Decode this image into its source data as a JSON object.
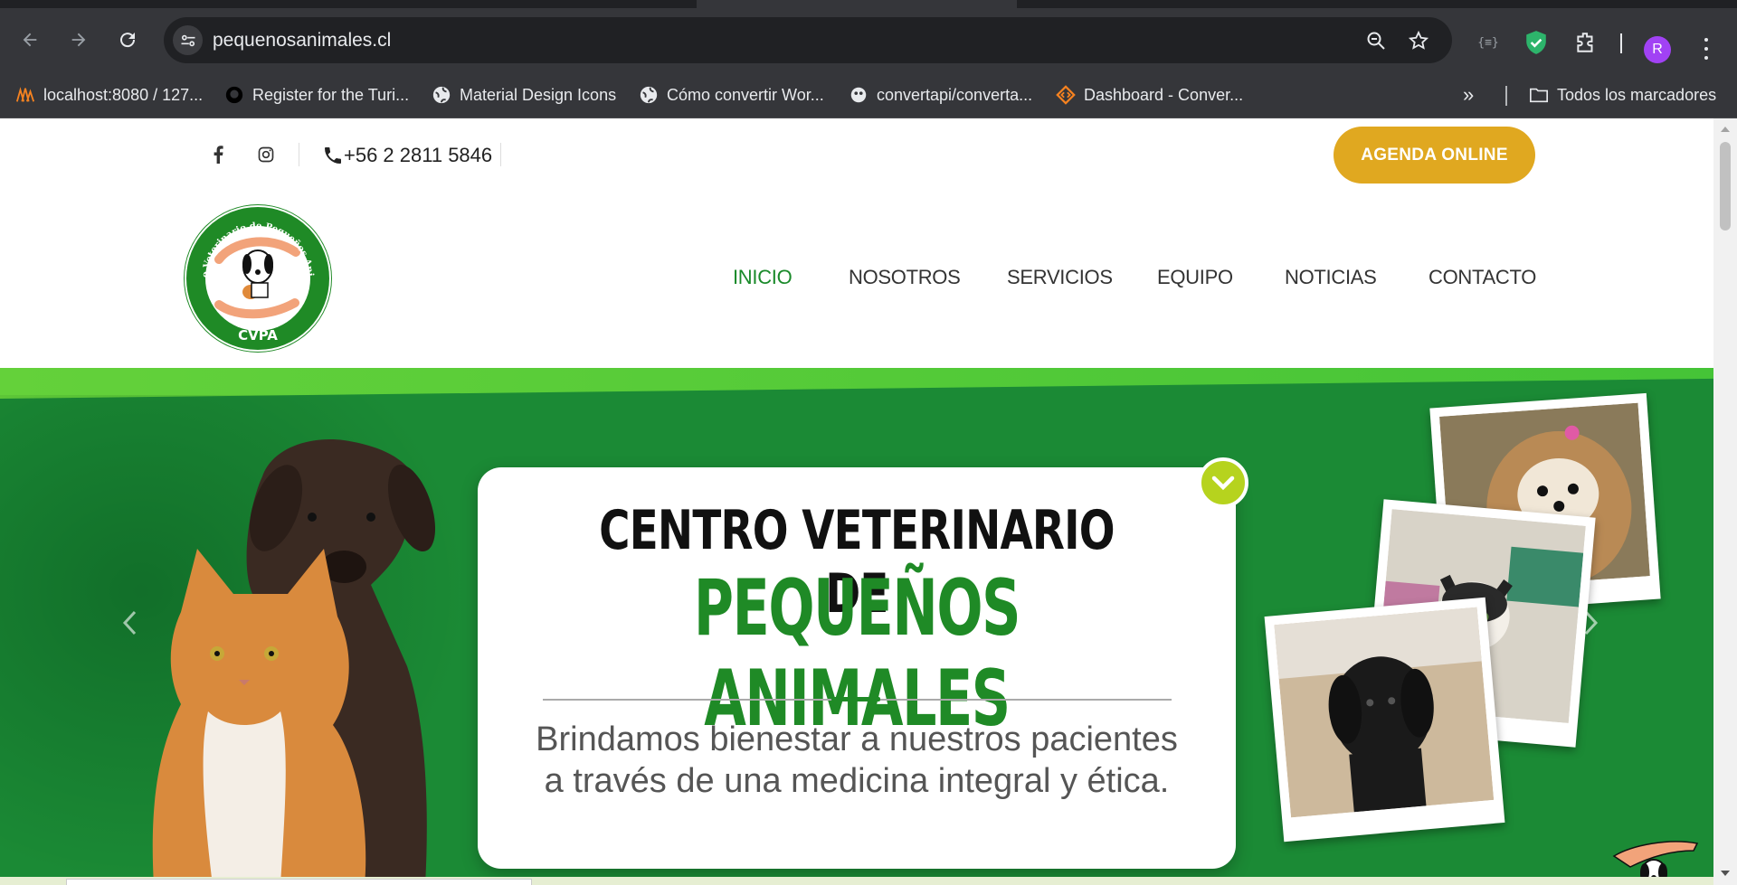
{
  "browser": {
    "url": "pequenosanimales.cl",
    "bookmarks": [
      {
        "label": "localhost:8080 / 127...",
        "icon": "phpmyadmin-icon"
      },
      {
        "label": "Register for the Turi...",
        "icon": "github-icon"
      },
      {
        "label": "Material Design Icons",
        "icon": "globe-icon"
      },
      {
        "label": "Cómo convertir Wor...",
        "icon": "globe-icon"
      },
      {
        "label": "convertapi/converta...",
        "icon": "convertapi-icon"
      },
      {
        "label": "Dashboard - Conver...",
        "icon": "convert-icon"
      }
    ],
    "all_bookmarks": "Todos los marcadores",
    "profile_initial": "R",
    "colors": {
      "chrome": "#35363a",
      "omnibox": "#202124",
      "avatar": "#a142f4"
    }
  },
  "site": {
    "phone": "+56 2 2811 5846",
    "cta": "AGENDA ONLINE",
    "logo_top_text": "Centro Veterinario de Pequeños Animales",
    "logo_bottom_text": "CVPA",
    "nav": [
      "INICIO",
      "NOSOTROS",
      "SERVICIOS",
      "EQUIPO",
      "NOTICIAS",
      "CONTACTO"
    ],
    "active_nav": "INICIO",
    "hero": {
      "title_line1": "CENTRO VETERINARIO DE",
      "title_line2": "PEQUEÑOS ANIMALES",
      "subtitle": "Brindamos bienestar a nuestros pacientes a través de una medicina integral y ética."
    },
    "colors": {
      "brand_green": "#1f8a26",
      "hero_bg": "#1b8a35",
      "cta": "#e0a820",
      "accent_lime": "#b6d31e"
    }
  }
}
